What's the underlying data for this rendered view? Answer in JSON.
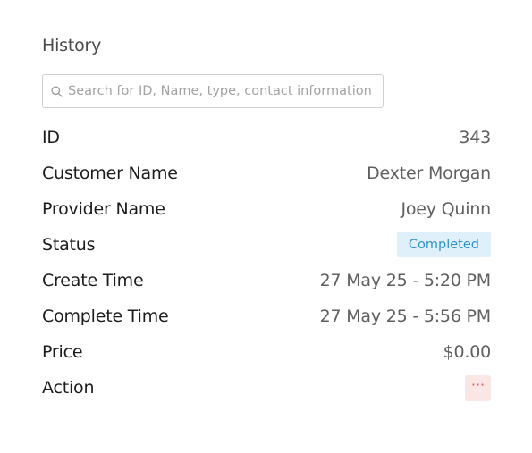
{
  "header": {
    "title": "History"
  },
  "search": {
    "placeholder": "Search for ID, Name, type, contact information",
    "value": ""
  },
  "details": {
    "id": {
      "label": "ID",
      "value": "343"
    },
    "customer_name": {
      "label": "Customer Name",
      "value": "Dexter Morgan"
    },
    "provider_name": {
      "label": "Provider Name",
      "value": "Joey Quinn"
    },
    "status": {
      "label": "Status",
      "value": "Completed"
    },
    "create_time": {
      "label": "Create Time",
      "value": "27 May 25 - 5:20 PM"
    },
    "complete_time": {
      "label": "Complete Time",
      "value": "27 May 25 - 5:56 PM"
    },
    "price": {
      "label": "Price",
      "value": "$0.00"
    },
    "action": {
      "label": "Action",
      "icon": "more-horizontal-icon",
      "glyph": "···"
    }
  },
  "colors": {
    "status_badge_bg": "#dff0fb",
    "status_badge_text": "#2f93c9",
    "action_bg": "#fbe6e6",
    "action_icon": "#e05555"
  }
}
